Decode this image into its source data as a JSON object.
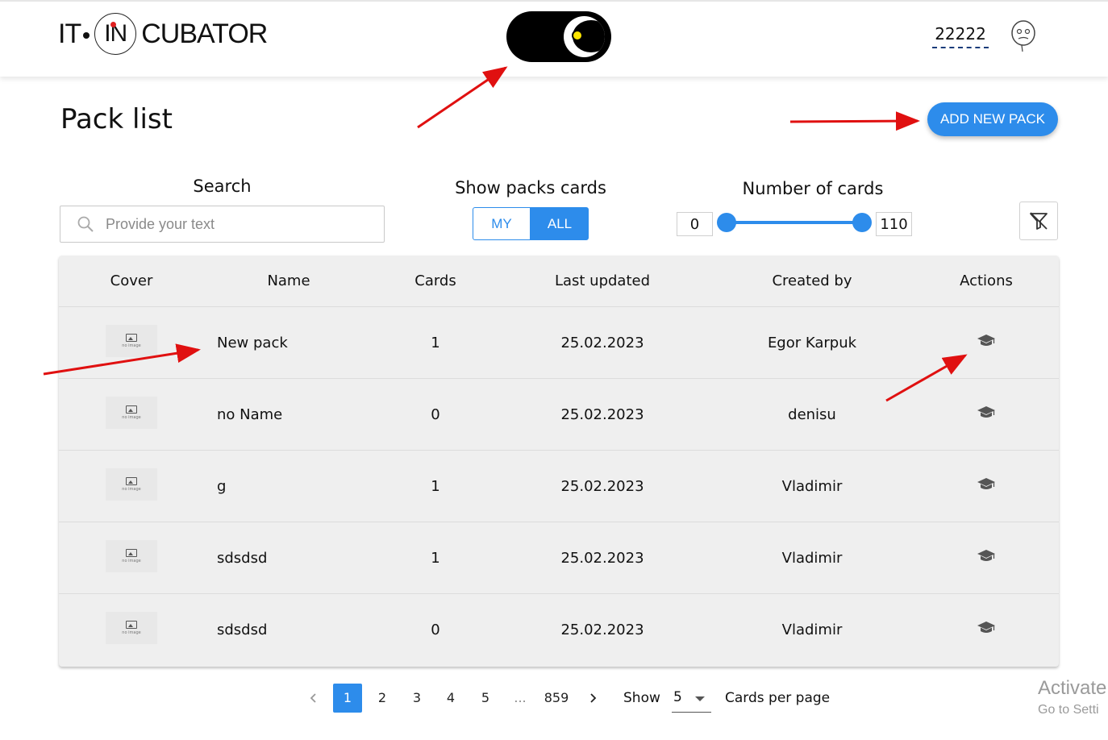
{
  "header": {
    "logo_left": "IT",
    "logo_circle": "IN",
    "logo_right": "CUBATOR",
    "username": "22222",
    "theme": "dark-mode-toggle"
  },
  "page": {
    "title": "Pack list",
    "add_button": "ADD NEW PACK"
  },
  "filters": {
    "search_label": "Search",
    "search_placeholder": "Provide your text",
    "show_label": "Show packs cards",
    "my_label": "MY",
    "all_label": "ALL",
    "selected_owner": "ALL",
    "range_label": "Number of cards",
    "range_min": "0",
    "range_max": "110"
  },
  "table": {
    "headers": [
      "Cover",
      "Name",
      "Cards",
      "Last updated",
      "Created by",
      "Actions"
    ],
    "cover_caption": "no image",
    "rows": [
      {
        "name": "New pack",
        "cards": "1",
        "updated": "25.02.2023",
        "created_by": "Egor Karpuk"
      },
      {
        "name": "no Name",
        "cards": "0",
        "updated": "25.02.2023",
        "created_by": "denisu"
      },
      {
        "name": "g",
        "cards": "1",
        "updated": "25.02.2023",
        "created_by": "Vladimir"
      },
      {
        "name": "sdsdsd",
        "cards": "1",
        "updated": "25.02.2023",
        "created_by": "Vladimir"
      },
      {
        "name": "sdsdsd",
        "cards": "0",
        "updated": "25.02.2023",
        "created_by": "Vladimir"
      }
    ]
  },
  "pagination": {
    "pages": [
      "1",
      "2",
      "3",
      "4",
      "5",
      "...",
      "859"
    ],
    "current": "1",
    "show_label": "Show",
    "per_page_value": "5",
    "per_page_label": "Cards per page"
  },
  "watermark": {
    "line1": "Activate",
    "line2": "Go to Setti"
  },
  "colors": {
    "accent": "#2d8ceb",
    "table_bg": "#efefef",
    "annotation_arrow": "#e01010"
  }
}
